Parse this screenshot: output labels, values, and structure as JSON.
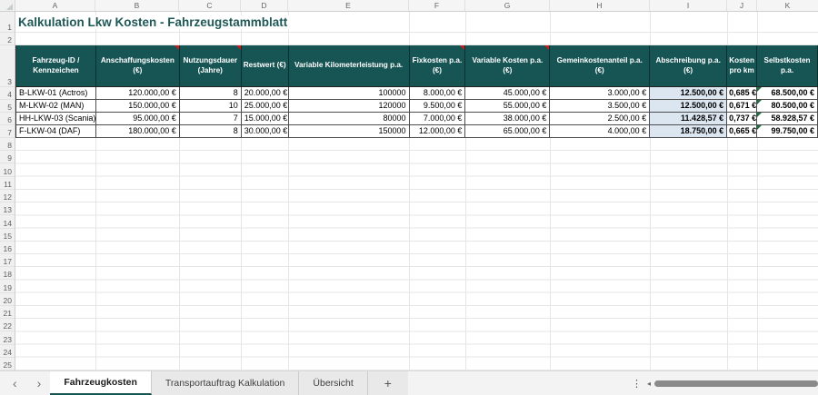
{
  "colors": {
    "header_bg": "#175454",
    "title_color": "#1e5856",
    "abschreibung_fill": "#dce6f1",
    "comment_indicator_red": "#cc1b1b",
    "formula_indicator_green": "#1d7044",
    "active_tab_underline": "#175454"
  },
  "grid": {
    "column_letters": [
      "A",
      "B",
      "C",
      "D",
      "E",
      "F",
      "G",
      "H",
      "I",
      "J",
      "K"
    ],
    "row_numbers": [
      "1",
      "2",
      "3",
      "4",
      "5",
      "6",
      "7",
      "8",
      "9",
      "10",
      "11",
      "12",
      "13",
      "14",
      "15",
      "16",
      "17",
      "18",
      "19",
      "20",
      "21",
      "22",
      "23",
      "24",
      "25"
    ]
  },
  "sheet": {
    "title": "Kalkulation Lkw Kosten - Fahrzeugstammblatt",
    "table": {
      "headers": [
        "Fahrzeug-ID / Kennzeichen",
        "Anschaffungskosten (€)",
        "Nutzungsdauer (Jahre)",
        "Restwert (€)",
        "Variable Kilometerleistung p.a.",
        "Fixkosten p.a. (€)",
        "Variable Kosten p.a. (€)",
        "Gemeinkostenanteil p.a. (€)",
        "Abschreibung p.a. (€)",
        "Kosten pro km",
        "Selbstkosten p.a."
      ],
      "comment_marked_headers": [
        "Anschaffungskosten (€)",
        "Nutzungsdauer (Jahre)",
        "Fixkosten p.a. (€)",
        "Variable Kosten p.a. (€)"
      ],
      "rows": [
        {
          "cells": [
            "B-LKW-01 (Actros)",
            "120.000,00 €",
            "8",
            "20.000,00 €",
            "100000",
            "8.000,00 €",
            "45.000,00 €",
            "3.000,00 €",
            "12.500,00 €",
            "0,685 €",
            "68.500,00 €"
          ]
        },
        {
          "cells": [
            "M-LKW-02 (MAN)",
            "150.000,00 €",
            "10",
            "25.000,00 €",
            "120000",
            "9.500,00 €",
            "55.000,00 €",
            "3.500,00 €",
            "12.500,00 €",
            "0,671 €",
            "80.500,00 €"
          ]
        },
        {
          "cells": [
            "HH-LKW-03 (Scania)",
            "95.000,00 €",
            "7",
            "15.000,00 €",
            "80000",
            "7.000,00 €",
            "38.000,00 €",
            "2.500,00 €",
            "11.428,57 €",
            "0,737 €",
            "58.928,57 €"
          ]
        },
        {
          "cells": [
            "F-LKW-04 (DAF)",
            "180.000,00 €",
            "8",
            "30.000,00 €",
            "150000",
            "12.000,00 €",
            "65.000,00 €",
            "4.000,00 €",
            "18.750,00 €",
            "0,665 €",
            "99.750,00 €"
          ]
        }
      ]
    }
  },
  "tabbar": {
    "nav_back": "‹",
    "nav_forward": "›",
    "tabs": [
      {
        "label": "Fahrzeugkosten",
        "active": true
      },
      {
        "label": "Transportauftrag Kalkulation",
        "active": false
      },
      {
        "label": "Übersicht",
        "active": false
      }
    ],
    "add_sheet": "+",
    "more": "⋮",
    "scroll_left_arrow": "◂"
  }
}
